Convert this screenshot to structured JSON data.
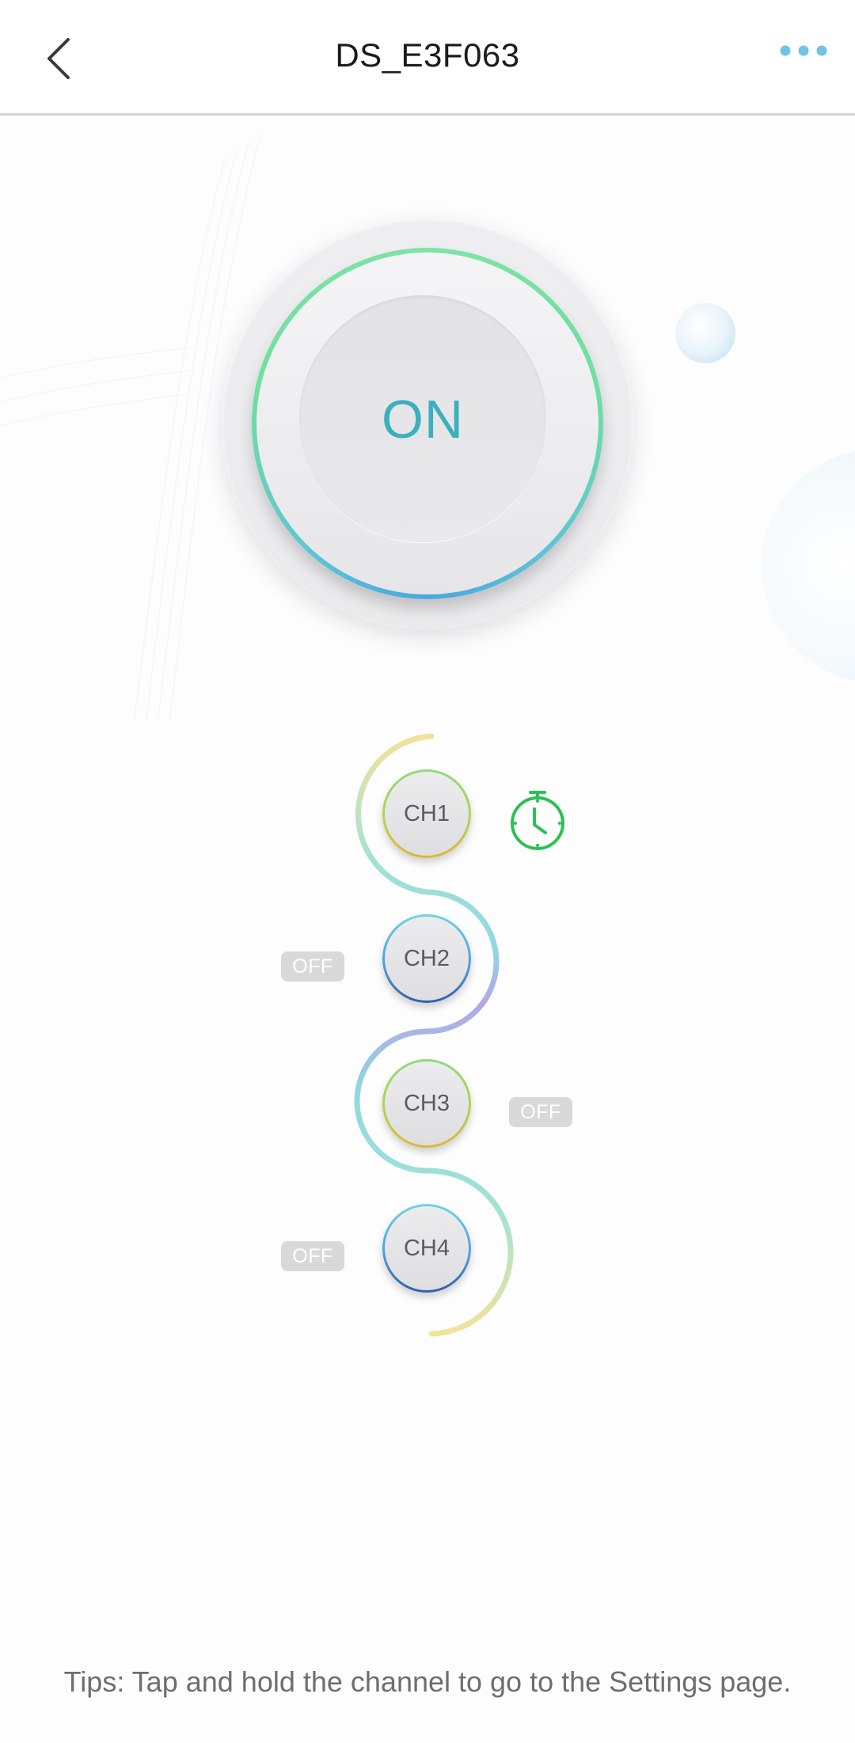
{
  "header": {
    "title": "DS_E3F063",
    "back_icon": "back-chevron-icon",
    "more_icon": "more-dots-icon"
  },
  "power": {
    "label": "ON",
    "state": "on"
  },
  "channels": [
    {
      "label": "CH1",
      "status": "",
      "has_timer": true
    },
    {
      "label": "CH2",
      "status": "OFF"
    },
    {
      "label": "CH3",
      "status": "OFF"
    },
    {
      "label": "CH4",
      "status": "OFF"
    }
  ],
  "tips": "Tips: Tap and hold the channel to go to the Settings page.",
  "colors": {
    "accent": "#3ab0bd",
    "ring_green": "#6fdfa0",
    "ring_blue": "#4aa8dc",
    "timer_green": "#2bc155",
    "more_dots": "#6fc3e8"
  }
}
